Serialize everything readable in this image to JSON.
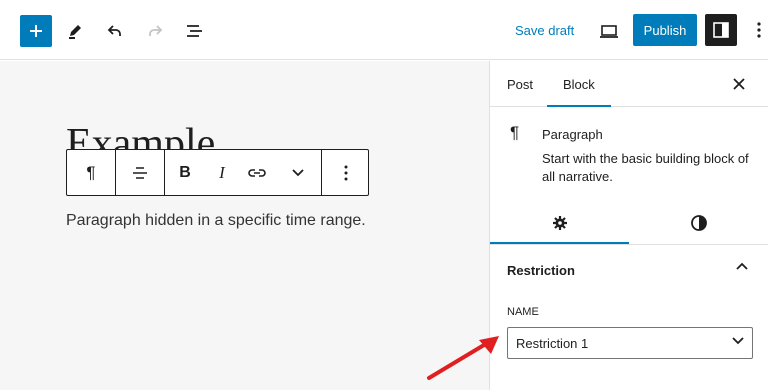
{
  "topbar": {
    "add_icon": "plus-icon",
    "tools_icon": "pencil-icon",
    "undo_icon": "undo-icon",
    "redo_icon": "redo-icon",
    "outline_icon": "list-view-icon",
    "save_draft_label": "Save draft",
    "preview_icon": "laptop-icon",
    "publish_label": "Publish",
    "settings_icon": "sidebar-toggle-icon",
    "more_icon": "vertical-ellipsis-icon"
  },
  "canvas": {
    "title": "Example",
    "paragraph": "Paragraph hidden in a specific time range.",
    "toolbar": {
      "block_type_icon": "pilcrow-icon",
      "align_icon": "align-icon",
      "bold_label": "B",
      "italic_label": "I",
      "link_icon": "link-icon",
      "more_rich_icon": "chevron-down-icon",
      "options_icon": "vertical-ellipsis-icon"
    }
  },
  "sidebar": {
    "tabs": [
      {
        "label": "Post"
      },
      {
        "label": "Block"
      }
    ],
    "active_tab": "Block",
    "close_icon": "close-icon",
    "block": {
      "icon": "pilcrow-icon",
      "title": "Paragraph",
      "description": "Start with the basic building block of all narrative."
    },
    "sub_tabs": [
      {
        "icon": "gear-icon",
        "active": true
      },
      {
        "icon": "contrast-icon",
        "active": false
      }
    ],
    "panel": {
      "title": "Restriction",
      "chevron_icon": "chevron-up-icon",
      "field_label": "NAME",
      "field_value": "Restriction 1",
      "field_chevron_icon": "chevron-down-icon"
    }
  },
  "colors": {
    "accent": "#007cba",
    "dark": "#1e1e1e",
    "canvas_bg": "#f6f6f6",
    "annotation": "#e02020"
  }
}
